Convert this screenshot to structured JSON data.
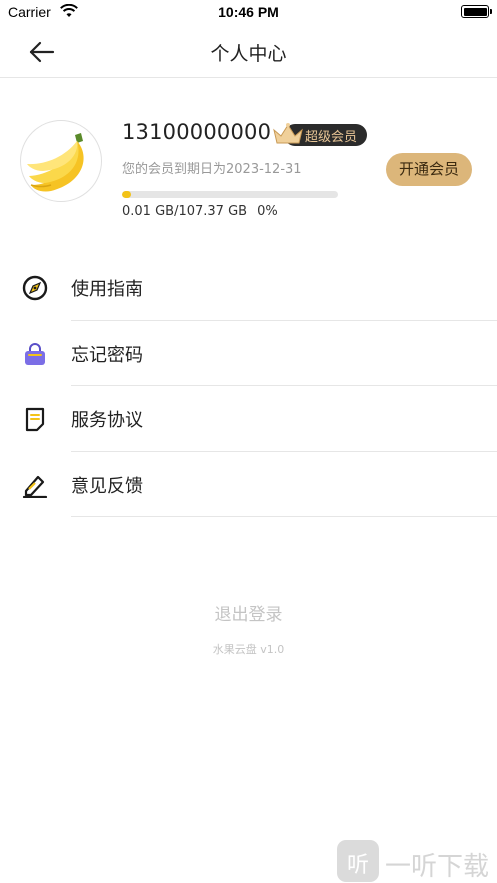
{
  "status_bar": {
    "carrier": "Carrier",
    "time": "10:46 PM",
    "wifi_icon": "wifi-icon",
    "battery_icon": "battery-full-icon"
  },
  "nav": {
    "title": "个人中心",
    "back_icon": "arrow-left-icon"
  },
  "profile": {
    "avatar_icon": "banana-icon",
    "phone": "13100000000",
    "vip_badge": "超级会员",
    "expire_text": "您的会员到期日为2023-12-31",
    "open_vip_label": "开通会员",
    "storage_used_total": "0.01 GB/107.37 GB",
    "storage_percent": "0%",
    "storage_fraction": 0.0001
  },
  "menu": {
    "items": [
      {
        "label": "使用指南",
        "icon": "compass-icon"
      },
      {
        "label": "忘记密码",
        "icon": "lock-icon"
      },
      {
        "label": "服务协议",
        "icon": "document-icon"
      },
      {
        "label": "意见反馈",
        "icon": "pencil-icon"
      }
    ]
  },
  "footer": {
    "logout_label": "退出登录",
    "version": "水果云盘 v1.0"
  },
  "watermark": {
    "logo_char": "听",
    "text": "一听下载"
  },
  "colors": {
    "accent_yellow": "#f3c318",
    "vip_gold": "#dcb67a",
    "badge_dark": "#2b2b2b",
    "lock_purple": "#7b6ee6"
  }
}
